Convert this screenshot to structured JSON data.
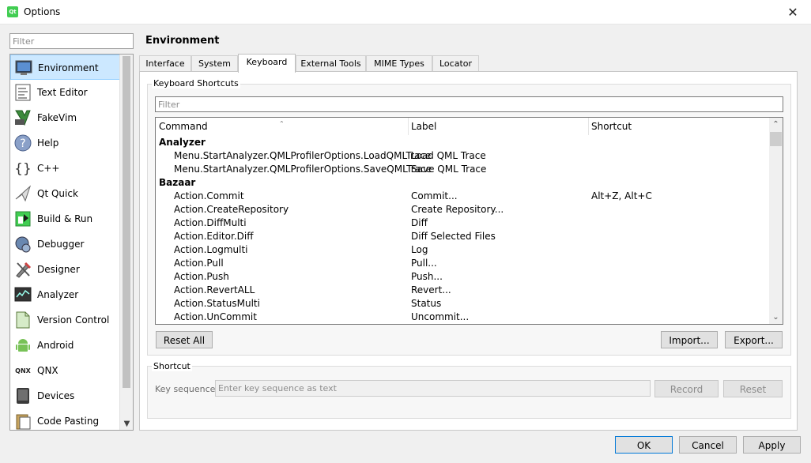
{
  "window": {
    "title": "Options",
    "app_icon_text": "Qt",
    "close_glyph": "✕"
  },
  "sidebar": {
    "filter_placeholder": "Filter",
    "items": [
      {
        "label": "Environment",
        "icon": "monitor-icon",
        "selected": true
      },
      {
        "label": "Text Editor",
        "icon": "text-editor-icon"
      },
      {
        "label": "FakeVim",
        "icon": "fakevim-icon"
      },
      {
        "label": "Help",
        "icon": "help-icon"
      },
      {
        "label": "C++",
        "icon": "braces-icon"
      },
      {
        "label": "Qt Quick",
        "icon": "qt-quick-icon"
      },
      {
        "label": "Build & Run",
        "icon": "build-run-icon"
      },
      {
        "label": "Debugger",
        "icon": "debugger-icon"
      },
      {
        "label": "Designer",
        "icon": "designer-icon"
      },
      {
        "label": "Analyzer",
        "icon": "analyzer-icon"
      },
      {
        "label": "Version Control",
        "icon": "version-control-icon"
      },
      {
        "label": "Android",
        "icon": "android-icon"
      },
      {
        "label": "QNX",
        "icon": "qnx-icon"
      },
      {
        "label": "Devices",
        "icon": "devices-icon"
      },
      {
        "label": "Code Pasting",
        "icon": "code-pasting-icon"
      }
    ]
  },
  "page": {
    "title": "Environment",
    "tabs": [
      "Interface",
      "System",
      "Keyboard",
      "External Tools",
      "MIME Types",
      "Locator"
    ],
    "active_tab": "Keyboard"
  },
  "shortcuts": {
    "group_title": "Keyboard Shortcuts",
    "filter_placeholder": "Filter",
    "columns": [
      "Command",
      "Label",
      "Shortcut"
    ],
    "rows": [
      {
        "command": "Analyzer",
        "label": "",
        "shortcut": "",
        "group": true
      },
      {
        "command": "Menu.StartAnalyzer.QMLProfilerOptions.LoadQMLTrace",
        "label": "Load QML Trace",
        "shortcut": ""
      },
      {
        "command": "Menu.StartAnalyzer.QMLProfilerOptions.SaveQMLTrace",
        "label": "Save QML Trace",
        "shortcut": ""
      },
      {
        "command": "Bazaar",
        "label": "",
        "shortcut": "",
        "group": true
      },
      {
        "command": "Action.Commit",
        "label": "Commit...",
        "shortcut": "Alt+Z, Alt+C"
      },
      {
        "command": "Action.CreateRepository",
        "label": "Create Repository...",
        "shortcut": ""
      },
      {
        "command": "Action.DiffMulti",
        "label": "Diff",
        "shortcut": ""
      },
      {
        "command": "Action.Editor.Diff",
        "label": "Diff Selected Files",
        "shortcut": ""
      },
      {
        "command": "Action.Logmulti",
        "label": "Log",
        "shortcut": ""
      },
      {
        "command": "Action.Pull",
        "label": "Pull...",
        "shortcut": ""
      },
      {
        "command": "Action.Push",
        "label": "Push...",
        "shortcut": ""
      },
      {
        "command": "Action.RevertALL",
        "label": "Revert...",
        "shortcut": ""
      },
      {
        "command": "Action.StatusMulti",
        "label": "Status",
        "shortcut": ""
      },
      {
        "command": "Action.UnCommit",
        "label": "Uncommit...",
        "shortcut": ""
      }
    ],
    "reset_all_label": "Reset All",
    "import_label": "Import...",
    "export_label": "Export..."
  },
  "shortcut_editor": {
    "group_title": "Shortcut",
    "key_sequence_label": "Key sequence:",
    "key_sequence_placeholder": "Enter key sequence as text",
    "record_label": "Record",
    "reset_label": "Reset"
  },
  "footer": {
    "ok_label": "OK",
    "cancel_label": "Cancel",
    "apply_label": "Apply"
  }
}
